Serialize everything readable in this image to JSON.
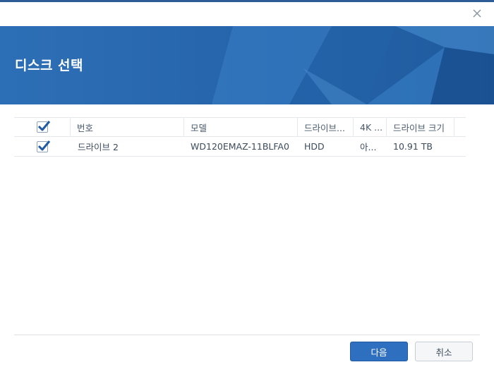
{
  "dialog": {
    "title": "디스크 선택",
    "close_icon": "close-icon"
  },
  "table": {
    "columns": [
      "번호",
      "모델",
      "드라이브...",
      "4K ...",
      "드라이브 크기"
    ],
    "header_checked": true,
    "rows": [
      {
        "checked": true,
        "number": "드라이브 2",
        "model": "WD120EMAZ-11BLFA0",
        "drive_type": "HDD",
        "native_4k": "아...",
        "size": "10.91 TB"
      }
    ]
  },
  "footer": {
    "next_label": "다음",
    "cancel_label": "취소"
  },
  "colors": {
    "accent": "#2f6fc0",
    "banner": "#2a6bb2",
    "check": "#1f5aa3"
  }
}
